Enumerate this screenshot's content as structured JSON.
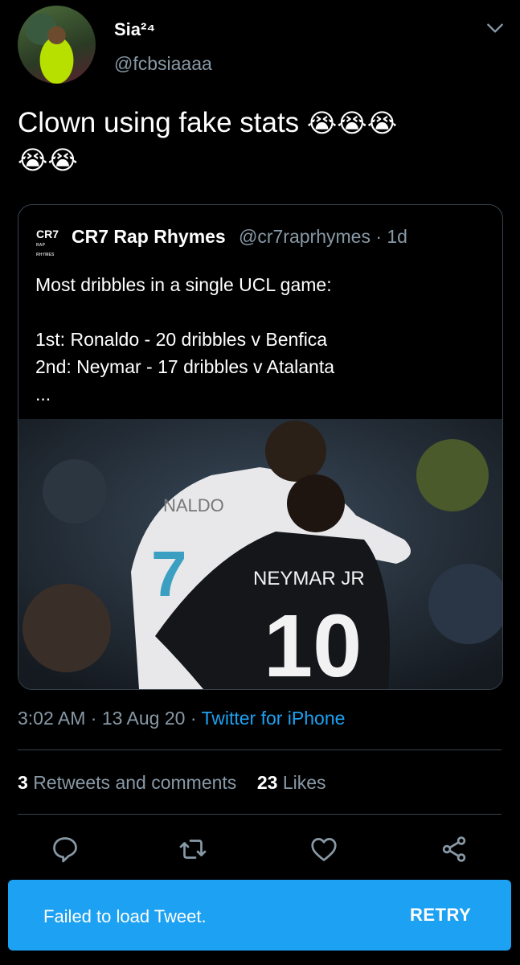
{
  "author": {
    "name": "Sia²⁴",
    "handle": "@fcbsiaaaa"
  },
  "tweet": {
    "text": "Clown using fake stats",
    "emoji": [
      "😭",
      "😭",
      "😭",
      "😭",
      "😭"
    ]
  },
  "quoted": {
    "logo_text": "CR7",
    "logo_subtext": "RAP RHYMES",
    "name": "CR7 Rap Rhymes",
    "handle_time": "@cr7raprhymes · 1d",
    "body": "Most dribbles in a single UCL game:\n\n1st: Ronaldo - 20 dribbles v Benfica\n2nd: Neymar - 17 dribbles v Atalanta\n...",
    "image_text": {
      "jersey_name_back": "NEYMAR JR",
      "jersey_number_back": "10",
      "jersey_name_front": "NALDO",
      "jersey_number_front": "7"
    }
  },
  "meta": {
    "time_date": "3:02 AM · 13 Aug 20 · ",
    "source": "Twitter for iPhone"
  },
  "stats": {
    "retweets_count": "3",
    "retweets_label": "Retweets and comments",
    "likes_count": "23",
    "likes_label": "Likes"
  },
  "toast": {
    "message": "Failed to load Tweet.",
    "action": "RETRY"
  },
  "colors": {
    "background": "#000000",
    "accent": "#1da1f2",
    "secondary_text": "#8899a6",
    "border": "#38444d"
  },
  "icons": [
    "chevron-down-icon",
    "reply-icon",
    "retweet-icon",
    "like-icon",
    "share-icon"
  ]
}
